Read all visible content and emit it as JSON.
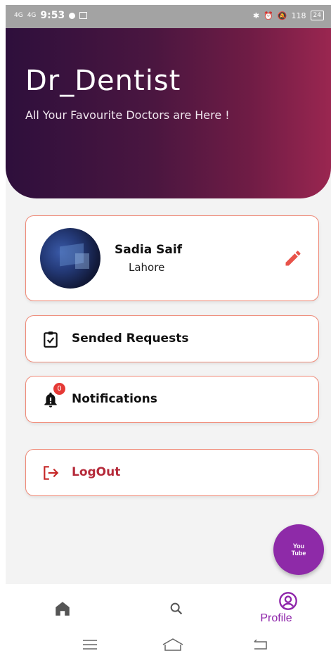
{
  "status_bar": {
    "network1": "4G",
    "network2": "4G",
    "time": "9:53",
    "speed": "118",
    "battery": "24"
  },
  "header": {
    "title": "Dr_Dentist",
    "subtitle": "All Your Favourite Doctors are Here !"
  },
  "profile": {
    "name": "Sadia Saif",
    "city": "Lahore"
  },
  "menu": {
    "requests_label": "Sended Requests",
    "notifications_label": "Notifications",
    "notifications_count": "0",
    "logout_label": "LogOut"
  },
  "fab": {
    "line1": "You",
    "line2": "Tube"
  },
  "bottom_nav": {
    "profile_label": "Profile"
  },
  "colors": {
    "accent": "#8e24aa",
    "card_border": "#ef8a78",
    "logout": "#b52a3a",
    "header_start": "#2e0f3c",
    "header_end": "#9a2650"
  },
  "icons": {
    "home": "home-icon",
    "search": "search-icon",
    "profile": "account-circle-icon",
    "edit": "pencil-icon",
    "requests": "clipboard-check-icon",
    "notifications": "bell-icon",
    "logout": "logout-icon",
    "fab": "youtube-icon"
  }
}
